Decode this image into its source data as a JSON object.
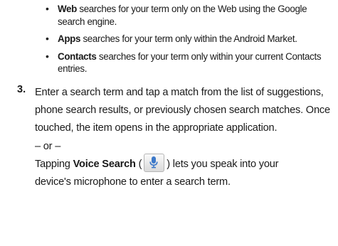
{
  "bullets": [
    {
      "term": "Web",
      "text": " searches for your term only on the Web using the Google search engine."
    },
    {
      "term": "Apps",
      "text": " searches for your term only within the Android Market."
    },
    {
      "term": "Contacts",
      "text": " searches for your term only within your current Contacts entries."
    }
  ],
  "step": {
    "number": "3.",
    "text": "Enter a search term and tap a match from the list of suggestions, phone search results, or previously chosen search matches. Once touched, the item opens in the appropriate application.",
    "or": "– or –",
    "voice_prefix": "Tapping ",
    "voice_term": "Voice Search",
    "voice_open": " (",
    "voice_close": ") lets you speak into your",
    "voice_suffix": "device's microphone to enter a search term."
  },
  "icons": {
    "bullet": "•",
    "voice_search": "microphone-icon"
  },
  "colors": {
    "text": "#1a1a1a",
    "mic_icon": "#3d79c9"
  }
}
